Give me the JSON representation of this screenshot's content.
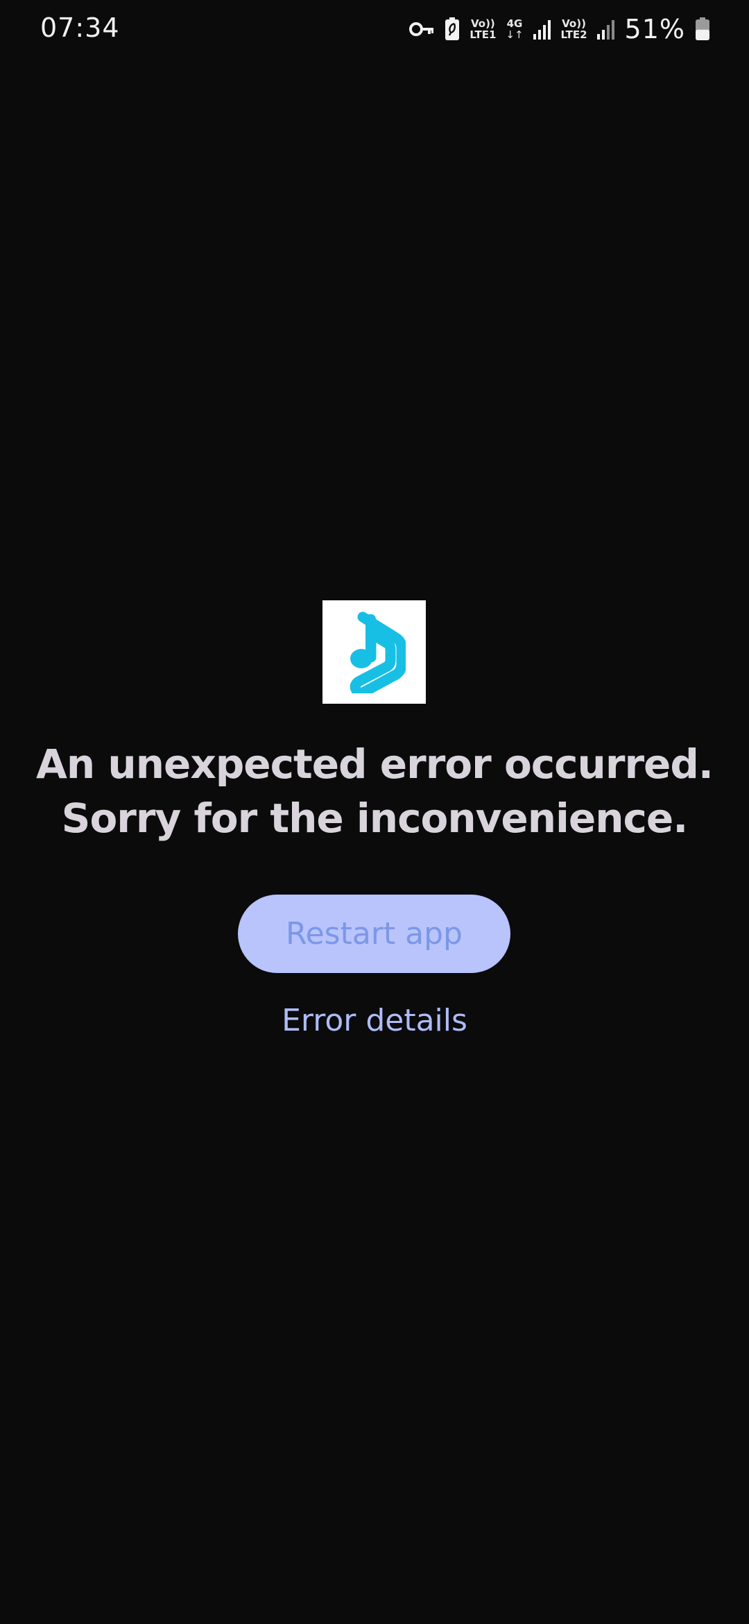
{
  "status_bar": {
    "time": "07:34",
    "icons": [
      "key-icon",
      "battery-saver-icon",
      "volte-icon",
      "data-arrows-icon",
      "signal-icon",
      "volte-icon",
      "signal-icon",
      "battery-icon"
    ],
    "sim1_top": "Vo))",
    "sim1_bottom": "LTE1",
    "network_type": "4G",
    "sim2_top": "Vo))",
    "sim2_bottom": "LTE2",
    "battery_percent": "51%",
    "battery_level": 0.51
  },
  "error_screen": {
    "logo": "music-note-app-logo",
    "title_line1": "An unexpected error occurred.",
    "title_line2": "Sorry for the inconvenience.",
    "restart_label": "Restart app",
    "details_label": "Error details"
  },
  "colors": {
    "background": "#0b0b0c",
    "title_text": "#d9d4dc",
    "button_bg": "#b8c4fb",
    "button_text": "#7c97e6",
    "link_text": "#aebcf7",
    "logo_accent": "#18bfe4"
  }
}
